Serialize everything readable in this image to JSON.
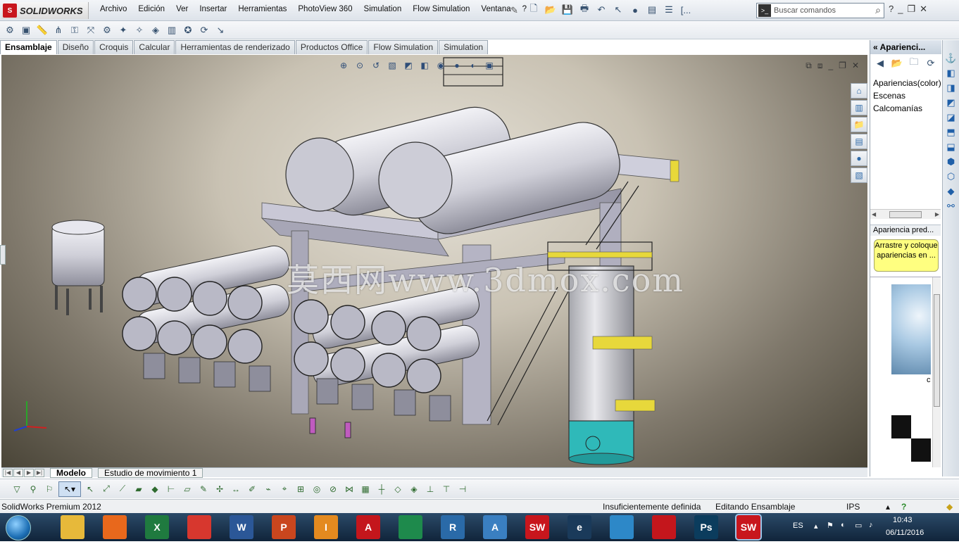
{
  "app": {
    "logo_text": "SOLIDWORKS",
    "menu": [
      "Archivo",
      "Edición",
      "Ver",
      "Insertar",
      "Herramientas",
      "PhotoView 360",
      "Simulation",
      "Flow Simulation",
      "Ventana",
      "?"
    ],
    "search_placeholder": "Buscar comandos",
    "overflow": "[..."
  },
  "command_tabs": [
    "Ensamblaje",
    "Diseño",
    "Croquis",
    "Calcular",
    "Herramientas de renderizado",
    "Productos Office",
    "Flow Simulation",
    "Simulation"
  ],
  "active_tab": "Ensamblaje",
  "viewport": {
    "watermark": "莫西网www.3dmox.com"
  },
  "model_tabs": [
    "Modelo",
    "Estudio de movimiento 1"
  ],
  "task_pane": {
    "title": "Aparienci...",
    "tree": [
      "Apariencias(color)",
      "Escenas",
      "Calcomanías"
    ],
    "subheader": "Apariencia pred...",
    "tip": "Arrastre y coloque apariencias en ...",
    "preview_label": "c"
  },
  "status": {
    "product": "SolidWorks Premium 2012",
    "definition": "Insuficientemente definida",
    "mode": "Editando Ensamblaje",
    "units": "IPS"
  },
  "taskbar": {
    "apps": [
      {
        "name": "file-explorer",
        "label": "",
        "color": "#e7b93a"
      },
      {
        "name": "firefox",
        "label": "",
        "color": "#e8681c"
      },
      {
        "name": "excel",
        "label": "X",
        "color": "#1f7a3f"
      },
      {
        "name": "chrome",
        "label": "",
        "color": "#d7372e"
      },
      {
        "name": "word",
        "label": "W",
        "color": "#2b5797"
      },
      {
        "name": "powerpoint",
        "label": "P",
        "color": "#c9461e"
      },
      {
        "name": "inventor-pro",
        "label": "I",
        "color": "#e48a1f"
      },
      {
        "name": "autocad",
        "label": "A",
        "color": "#c4161c"
      },
      {
        "name": "green-app",
        "label": "",
        "color": "#1e8a4c"
      },
      {
        "name": "revit",
        "label": "R",
        "color": "#2a6aa8"
      },
      {
        "name": "autodesk-p360",
        "label": "A",
        "color": "#3a7fc1"
      },
      {
        "name": "solidworks",
        "label": "SW",
        "color": "#c8161d"
      },
      {
        "name": "edrawings",
        "label": "e",
        "color": "#1a3a5a"
      },
      {
        "name": "browser",
        "label": "",
        "color": "#2d88c8"
      },
      {
        "name": "acrobat",
        "label": "",
        "color": "#c4161c"
      },
      {
        "name": "photoshop",
        "label": "Ps",
        "color": "#0b3c5d"
      },
      {
        "name": "solidworks-active",
        "label": "SW",
        "color": "#c8161d"
      }
    ],
    "language": "ES",
    "time": "10:43",
    "date": "06/11/2016"
  }
}
